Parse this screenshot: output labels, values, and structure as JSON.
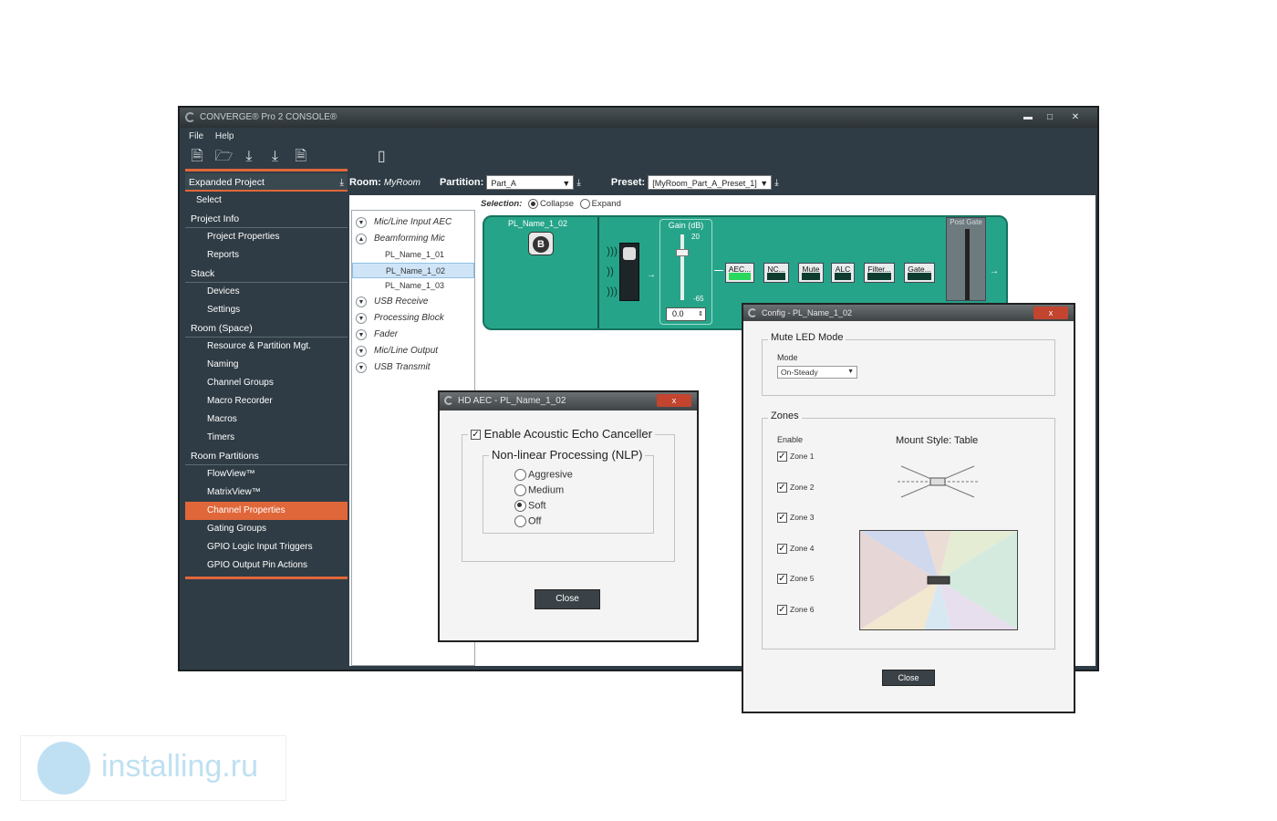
{
  "window": {
    "title": "CONVERGE® Pro 2 CONSOLE®",
    "menu": [
      "File",
      "Help"
    ]
  },
  "header": {
    "room_label": "Room:",
    "room_value": "MyRoom",
    "partition_label": "Partition:",
    "partition_value": "Part_A",
    "preset_label": "Preset:",
    "preset_value": "[MyRoom_Part_A_Preset_1]"
  },
  "sidebar": {
    "header": "Expanded Project",
    "items": [
      {
        "label": "Select",
        "kind": "item"
      },
      {
        "label": "Project Info",
        "kind": "section"
      },
      {
        "label": "Project Properties",
        "kind": "item"
      },
      {
        "label": "Reports",
        "kind": "item"
      },
      {
        "label": "Stack",
        "kind": "section"
      },
      {
        "label": "Devices",
        "kind": "item"
      },
      {
        "label": "Settings",
        "kind": "item"
      },
      {
        "label": "Room (Space)",
        "kind": "section"
      },
      {
        "label": "Resource & Partition Mgt.",
        "kind": "item"
      },
      {
        "label": "Naming",
        "kind": "item"
      },
      {
        "label": "Channel Groups",
        "kind": "item"
      },
      {
        "label": "Macro Recorder",
        "kind": "item"
      },
      {
        "label": "Macros",
        "kind": "item"
      },
      {
        "label": "Timers",
        "kind": "item"
      },
      {
        "label": "Room Partitions",
        "kind": "section"
      },
      {
        "label": "FlowView™",
        "kind": "item"
      },
      {
        "label": "MatrixView™",
        "kind": "item"
      },
      {
        "label": "Channel Properties",
        "kind": "item",
        "active": true
      },
      {
        "label": "Gating Groups",
        "kind": "item"
      },
      {
        "label": "GPIO Logic Input Triggers",
        "kind": "item"
      },
      {
        "label": "GPIO Output Pin Actions",
        "kind": "item"
      }
    ]
  },
  "selection": {
    "label": "Selection:",
    "collapse": "Collapse",
    "expand": "Expand"
  },
  "tree": [
    {
      "label": "Mic/Line Input AEC",
      "type": "group",
      "state": "v"
    },
    {
      "label": "Beamforming Mic",
      "type": "group",
      "state": "^"
    },
    {
      "label": "PL_Name_1_01",
      "type": "sub"
    },
    {
      "label": "PL_Name_1_02",
      "type": "sub",
      "selected": true
    },
    {
      "label": "PL_Name_1_03",
      "type": "sub"
    },
    {
      "label": "USB Receive",
      "type": "group",
      "state": "v"
    },
    {
      "label": "Processing Block",
      "type": "group",
      "state": "v"
    },
    {
      "label": "Fader",
      "type": "group",
      "state": "v"
    },
    {
      "label": "Mic/Line Output",
      "type": "group",
      "state": "v"
    },
    {
      "label": "USB Transmit",
      "type": "group",
      "state": "v"
    }
  ],
  "block": {
    "name": "PL_Name_1_02",
    "badge": "B",
    "gain_label": "Gain (dB)",
    "gain_max": "20",
    "gain_min": "-65",
    "gain_value": "0.0",
    "buttons": [
      {
        "label": "AEC...",
        "on": true
      },
      {
        "label": "NC...",
        "on": false
      },
      {
        "label": "Mute",
        "on": false
      },
      {
        "label": "ALC",
        "on": false
      },
      {
        "label": "Filter...",
        "on": false
      },
      {
        "label": "Gate...",
        "on": false
      }
    ],
    "post_gate": "Post Gate"
  },
  "aec_dialog": {
    "title": "HD AEC - PL_Name_1_02",
    "close_x": "x",
    "enable_label": "Enable Acoustic Echo Canceller",
    "nlp_label": "Non-linear Processing (NLP)",
    "options": [
      "Aggresive",
      "Medium",
      "Soft",
      "Off"
    ],
    "selected": "Soft",
    "close_button": "Close"
  },
  "config_dialog": {
    "title": "Config - PL_Name_1_02",
    "close_x": "x",
    "mute_led_label": "Mute LED Mode",
    "mode_label": "Mode",
    "mode_value": "On-Steady",
    "zones_label": "Zones",
    "enable_label": "Enable",
    "mount_style": "Mount Style: Table",
    "zones": [
      "Zone 1",
      "Zone 2",
      "Zone 3",
      "Zone 4",
      "Zone 5",
      "Zone 6"
    ],
    "close_button": "Close"
  },
  "watermark": {
    "text": "installing.ru"
  },
  "colors": {
    "accent_orange": "#e0673a",
    "panel_dark": "#2f3c45",
    "block_green": "#26a489",
    "led_green": "#29d85c"
  }
}
